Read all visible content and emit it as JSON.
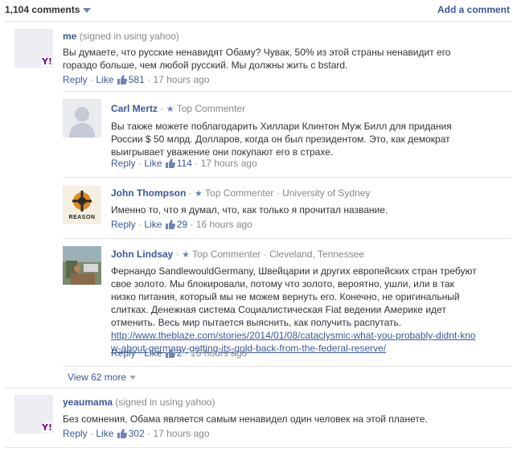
{
  "header": {
    "comment_count": "1,104 comments",
    "add_comment": "Add a comment"
  },
  "comments": [
    {
      "name": "me",
      "signed": "(signed in using yahoo)",
      "text": "Вы думаете, что русские ненавидят Обаму? Чувак, 50% из этой страны ненавидит его гораздо больше, чем любой русский. Мы должны жить с bstard.",
      "reply": "Reply",
      "like": "Like",
      "likes": "581",
      "time": "17 hours ago"
    },
    {
      "name": "Carl Mertz",
      "badge": "Top Commenter",
      "text": "Вы также можете поблагодарить Хиллари Клинтон Муж Билл для придания России $ 50 млрд. Долларов, когда он был президентом. Это, как демократ выигрывает уважение они покупают его в страхе.",
      "reply": "Reply",
      "like": "Like",
      "likes": "114",
      "time": "17 hours ago"
    },
    {
      "name": "John Thompson",
      "badge": "Top Commenter",
      "location": "University of Sydney",
      "avatar_text": "REASON",
      "text": "Именно то, что я думал, что, как только я прочитал название.",
      "reply": "Reply",
      "like": "Like",
      "likes": "29",
      "time": "16 hours ago"
    },
    {
      "name": "John Lindsay",
      "badge": "Top Commenter",
      "location": "Cleveland, Tennessee",
      "text": "Фернандо SandlewouldGermany, Швейцарии и других европейских стран требуют свое золото. Мы блокировали, потому что золото, вероятно, ушли, или в так низко питания, который мы не можем вернуть его. Конечно, не оригинальный слитках. Денежная система Социалистическая Fiat ведении Америке идет отменить. Весь мир пытается выяснить, как получить распутать.",
      "link": "http://www.theblaze.com/stories/2014/01/08/cataclysmic-what-you-probably-didnt-know-about-germany-getting-its-gold-back-from-the-federal-reserve/",
      "reply": "Reply",
      "like": "Like",
      "likes": "2",
      "time": "16 hours ago"
    },
    {
      "name": "yeaumama",
      "signed": "(signed in using yahoo)",
      "text": "Без сомнения, Обама является самым ненавидел один человек на этой планете.",
      "reply": "Reply",
      "like": "Like",
      "likes": "302",
      "time": "17 hours ago"
    }
  ],
  "view_more": "View 62 more",
  "yahoo_badge": "Y!",
  "colors": {
    "link": "#3b5998",
    "meta": "#888888",
    "separator": "#e5e5e5",
    "yahoo": "#7b0099"
  }
}
